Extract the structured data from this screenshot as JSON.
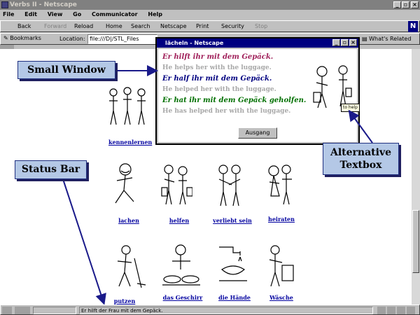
{
  "window": {
    "title": "Verbs II - Netscape"
  },
  "menu": [
    "File",
    "Edit",
    "View",
    "Go",
    "Communicator",
    "Help"
  ],
  "toolbar": {
    "buttons": [
      {
        "label": "Back",
        "enabled": true
      },
      {
        "label": "Forward",
        "enabled": false
      },
      {
        "label": "Reload",
        "enabled": true
      },
      {
        "label": "Home",
        "enabled": true
      },
      {
        "label": "Search",
        "enabled": true
      },
      {
        "label": "Netscape",
        "enabled": true
      },
      {
        "label": "Print",
        "enabled": true
      },
      {
        "label": "Security",
        "enabled": true
      },
      {
        "label": "Stop",
        "enabled": false
      }
    ],
    "logo": "N"
  },
  "location_bar": {
    "bookmarks": "Bookmarks",
    "location_label": "Location:",
    "location_value": "file:///D|/STL_Files",
    "whats_related": "What's Related"
  },
  "captions": {
    "row1": "kennenlernen",
    "row2": [
      "lachen",
      "helfen",
      "verliebt sein",
      "heiraten"
    ],
    "row3": [
      "putzen",
      "das Geschirr",
      "die Hände",
      "Wäsche"
    ]
  },
  "popup": {
    "title": "lächeln - Netscape",
    "lines": [
      {
        "text": "Er hilft ihr mit dem Gepäck.",
        "color": "#a0205a"
      },
      {
        "text": "He helps her with the luggage.",
        "color": "#a8a8a8"
      },
      {
        "text": "Er half ihr mit dem Gepäck.",
        "color": "#000080"
      },
      {
        "text": "He helped her with the luggage.",
        "color": "#a8a8a8"
      },
      {
        "text": "Er hat ihr mit dem Gepäck geholfen.",
        "color": "#007000"
      },
      {
        "text": "He has helped her with the luggage.",
        "color": "#a8a8a8"
      }
    ],
    "button": "Ausgang",
    "tooltip": "to help"
  },
  "callouts": {
    "small_window": "Small Window",
    "status_bar": "Status Bar",
    "alt_line1": "Alternative",
    "alt_line2": "Textbox"
  },
  "status": {
    "text": "Er hilft der Frau mit dem Gepäck."
  },
  "colors": {
    "callout_bg": "#b4c8e6",
    "arrow": "#1a1a8a",
    "title_active": "#000080"
  }
}
